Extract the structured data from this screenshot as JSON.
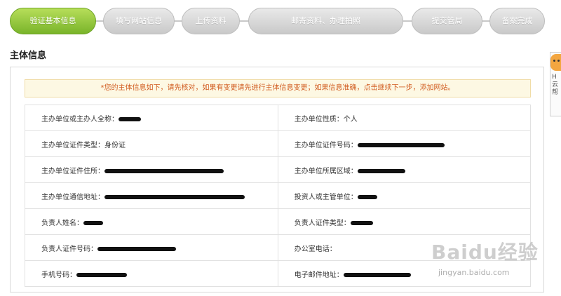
{
  "steps": [
    {
      "label": "验证基本信息",
      "active": true
    },
    {
      "label": "填写网站信息",
      "active": false
    },
    {
      "label": "上传资料",
      "active": false
    },
    {
      "label": "邮寄资料、办理拍照",
      "active": false
    },
    {
      "label": "提交管局",
      "active": false
    },
    {
      "label": "备案完成",
      "active": false
    }
  ],
  "section_title": "主体信息",
  "notice": "*您的主体信息如下，请先核对，如果有变更请先进行主体信息变更；如果信息准确，点击继续下一步，添加网站。",
  "rows": [
    {
      "left_label": "主办单位或主办人全称：",
      "left_value": "",
      "right_label": "主办单位性质：",
      "right_value": "个人"
    },
    {
      "left_label": "主办单位证件类型：",
      "left_value": "身份证",
      "right_label": "主办单位证件号码：",
      "right_value": ""
    },
    {
      "left_label": "主办单位证件住所：",
      "left_value": "",
      "right_label": "主办单位所属区域：",
      "right_value": ""
    },
    {
      "left_label": "主办单位通信地址：",
      "left_value": "",
      "right_label": "投资人或主管单位：",
      "right_value": ""
    },
    {
      "left_label": "负责人姓名：",
      "left_value": "",
      "right_label": "负责人证件类型：",
      "right_value": ""
    },
    {
      "left_label": "负责人证件号码：",
      "left_value": "",
      "right_label": "办公室电话：",
      "right_value": ""
    },
    {
      "left_label": "手机号码：",
      "left_value": "",
      "right_label": "电子邮件地址：",
      "right_value": ""
    }
  ],
  "side_widget": {
    "text": "H云帮"
  },
  "watermark": {
    "logo": "Baidu经验",
    "url": "jingyan.baidu.com"
  },
  "colors": {
    "active_step": "#8cc43a",
    "inactive_step": "#d4d4d4",
    "notice_text": "#d15b1f",
    "notice_bg": "#fdf8e3"
  }
}
